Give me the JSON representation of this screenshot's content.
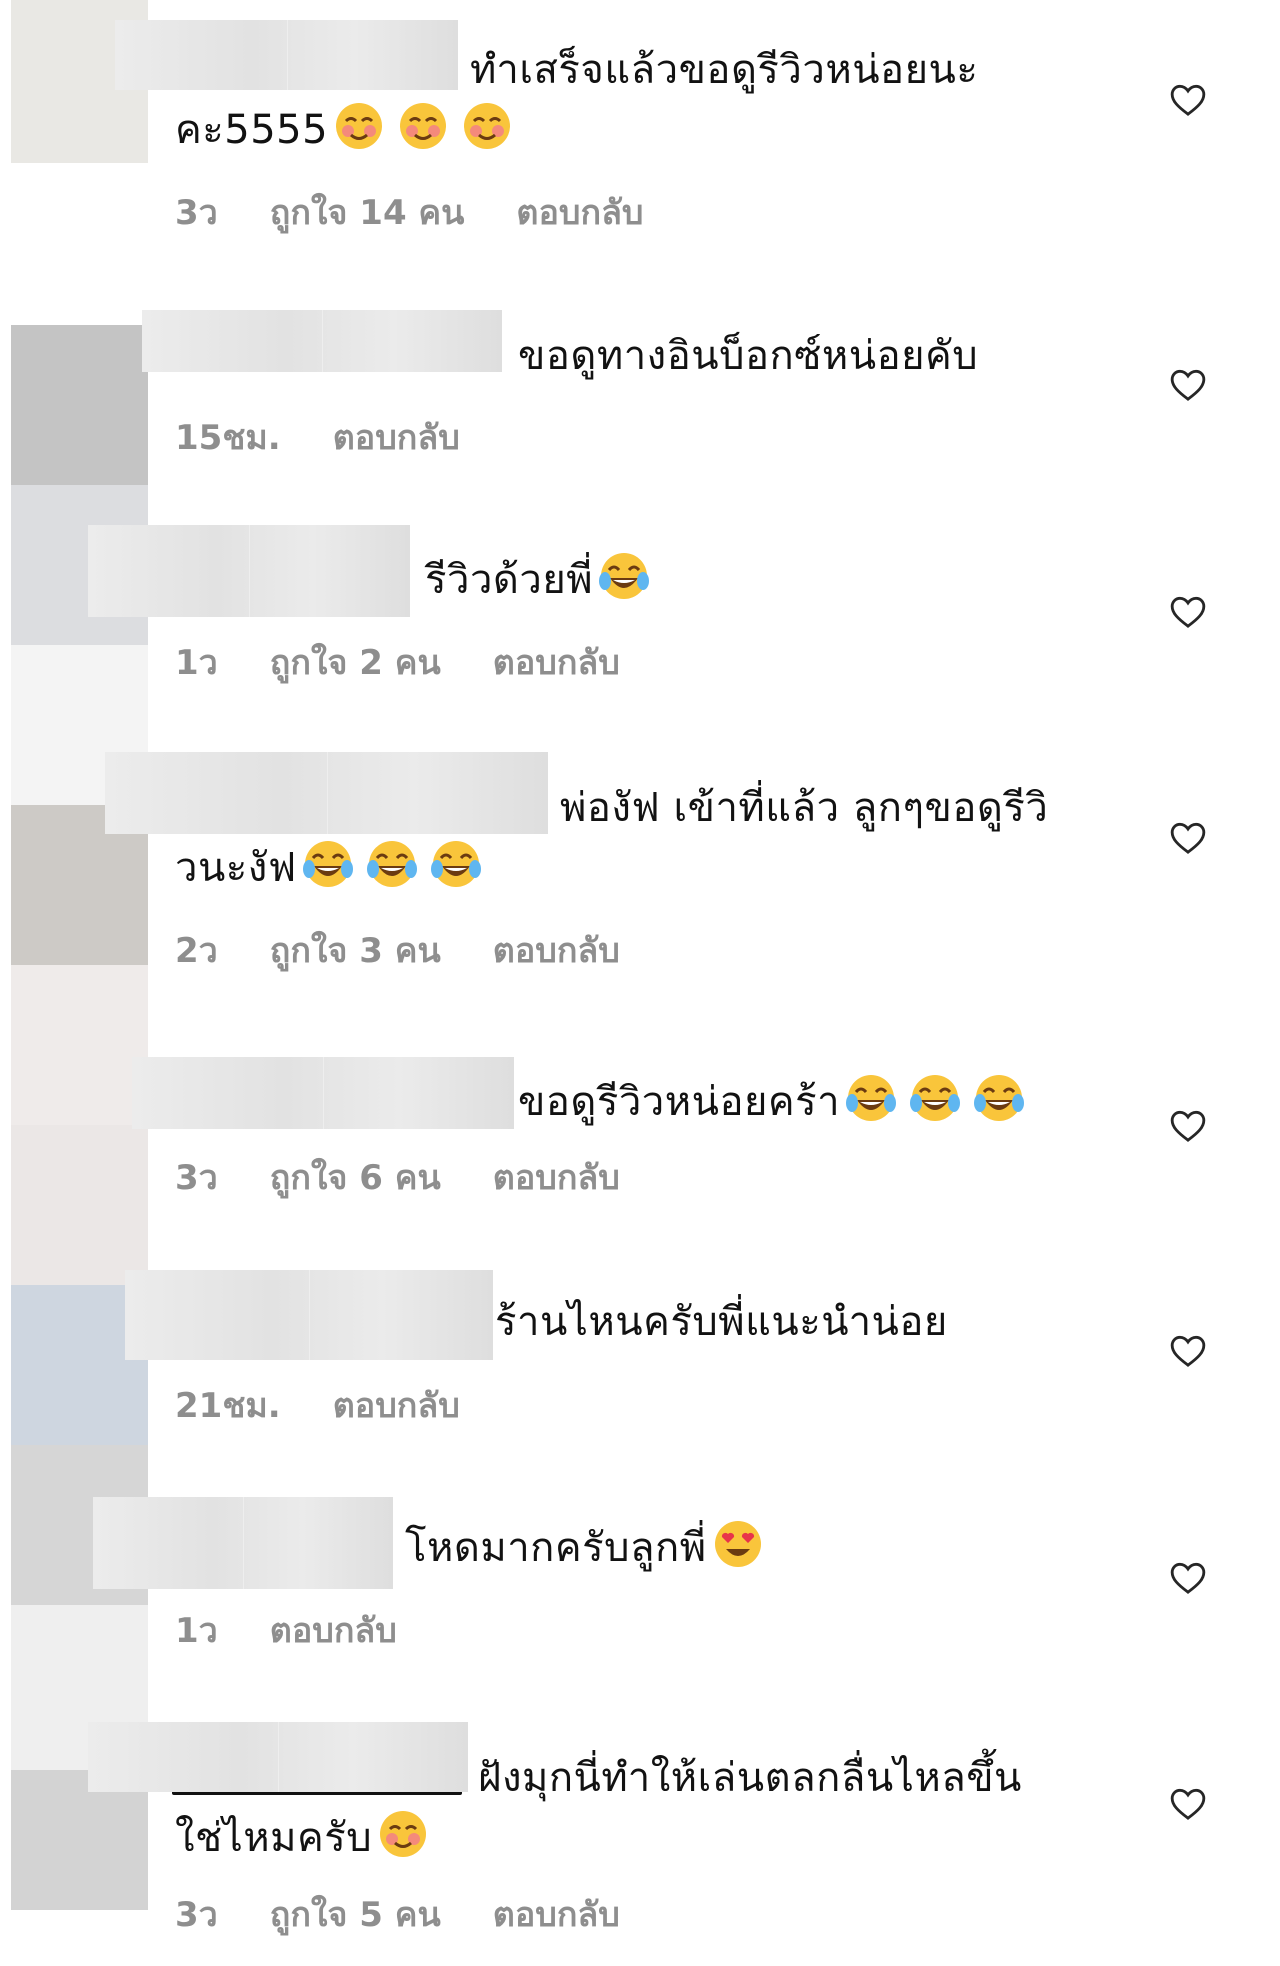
{
  "comments": [
    {
      "line1": "ทำเสร็จแล้วขอดูรีวิวหน่อยนะ",
      "line2": "คะ5555",
      "time": "3ว",
      "likes": "ถูกใจ 14 คน",
      "reply": "ตอบกลับ"
    },
    {
      "line1": "ขอดูทางอินบ็อกซ์หน่อยคับ",
      "line2": "",
      "time": "15ชม.",
      "likes": "",
      "reply": "ตอบกลับ"
    },
    {
      "line1": "รีวิวด้วยพี่",
      "line2": "",
      "time": "1ว",
      "likes": "ถูกใจ 2 คน",
      "reply": "ตอบกลับ"
    },
    {
      "line1": "พ่องัฟ เข้าที่แล้ว ลูกๆขอดูรีวิ",
      "line2": "วนะงัฟ",
      "time": "2ว",
      "likes": "ถูกใจ 3 คน",
      "reply": "ตอบกลับ"
    },
    {
      "line1": "ขอดูรีวิวหน่อยคร้า",
      "line2": "",
      "time": "3ว",
      "likes": "ถูกใจ 6 คน",
      "reply": "ตอบกลับ"
    },
    {
      "line1": "ร้านไหนครับพี่แนะนำน่อย",
      "line2": "",
      "time": "21ชม.",
      "likes": "",
      "reply": "ตอบกลับ"
    },
    {
      "line1": "โหดมากครับลูกพี่",
      "line2": "",
      "time": "1ว",
      "likes": "",
      "reply": "ตอบกลับ"
    },
    {
      "line1": "ฝังมุกนี่ทำให้เล่นตลกลื่นไหลขึ้น",
      "line2": "ใช่ไหมครับ",
      "time": "3ว",
      "likes": "ถูกใจ 5 คน",
      "reply": "ตอบกลับ"
    }
  ],
  "colors": {
    "meta_gray": "#8e8e8e",
    "text": "#121212",
    "heart_stroke": "#262626"
  }
}
